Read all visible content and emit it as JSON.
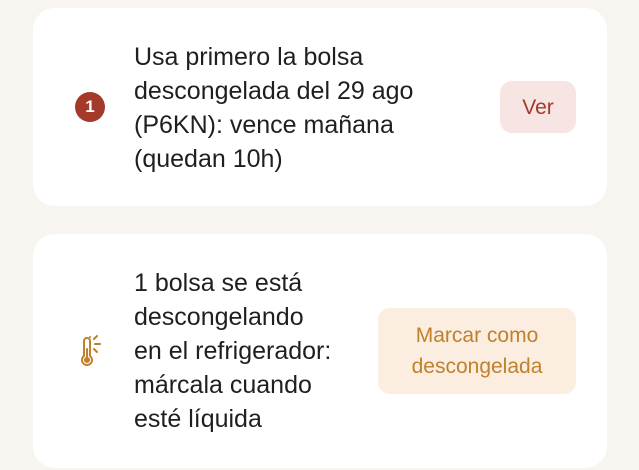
{
  "alerts": [
    {
      "badge": "1",
      "message": "Usa primero la bolsa\ndescongelada del 29 ago\n(P6KN): vence mañana\n(quedan 10h)",
      "action": "Ver",
      "accent_color": "#a33a2c"
    },
    {
      "icon": "thermometer-sun-icon",
      "message": "1 bolsa se está\ndescongelando\nen el refrigerador:\nmárcala cuando\nesté líquida",
      "action": "Marcar como\ndescongelada",
      "accent_color": "#c0802c"
    }
  ]
}
